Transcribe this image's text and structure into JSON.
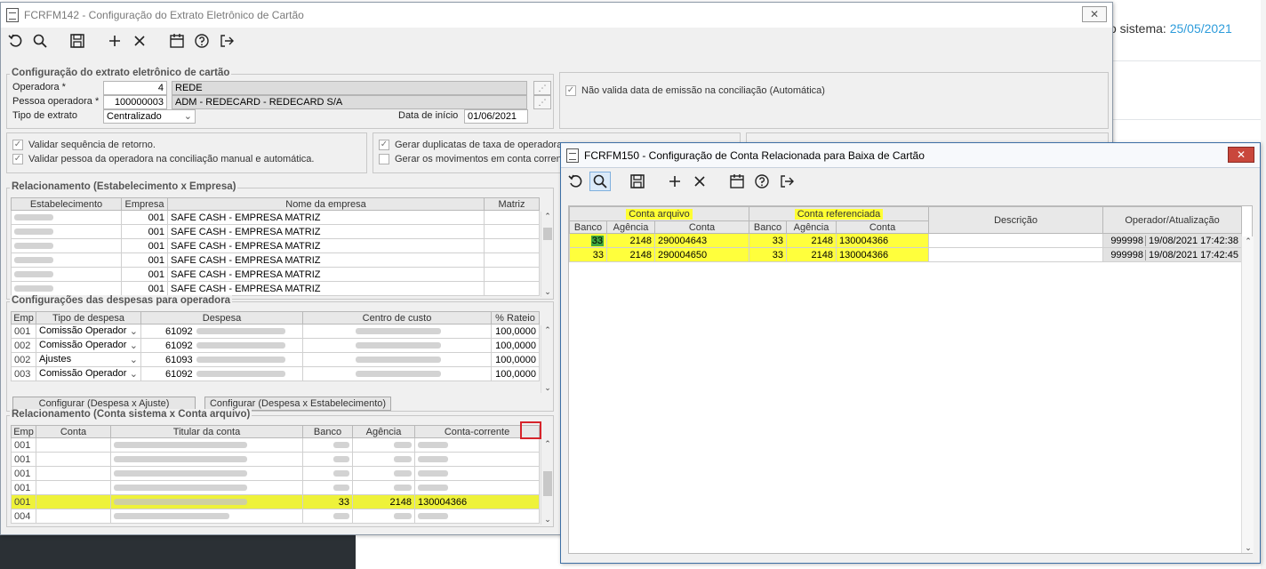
{
  "background": {
    "system_date_label": "o sistema:",
    "system_date": "25/05/2021"
  },
  "win1": {
    "title": "FCRFM142 - Configuração do Extrato Eletrônico de Cartão",
    "close": "✕",
    "config_group": {
      "label": "Configuração do extrato eletrônico de cartão",
      "operadora_label": "Operadora *",
      "operadora_value": "4",
      "operadora_name": "REDE",
      "pessoa_label": "Pessoa operadora *",
      "pessoa_value": "100000003",
      "pessoa_name": "ADM - REDECARD - REDECARD S/A",
      "tipo_label": "Tipo de extrato",
      "tipo_value": "Centralizado",
      "data_label": "Data de início",
      "data_value": "01/06/2021",
      "nao_valida": "Não valida data de emissão na conciliação (Automática)"
    },
    "checks": {
      "validar_seq": "Validar sequência de retorno.",
      "validar_pessoa": "Validar pessoa da operadora na conciliação manual e automática.",
      "gerar_dup": "Gerar duplicatas de taxa de operadora",
      "gerar_mov": "Gerar os movimentos em conta corren"
    },
    "rel_estab": {
      "label": "Relacionamento (Estabelecimento x Empresa)",
      "headers": [
        "Estabelecimento",
        "Empresa",
        "Nome da empresa",
        "Matriz"
      ],
      "rows": [
        {
          "empresa": "001",
          "nome": "SAFE CASH - EMPRESA MATRIZ"
        },
        {
          "empresa": "001",
          "nome": "SAFE CASH - EMPRESA MATRIZ"
        },
        {
          "empresa": "001",
          "nome": "SAFE CASH - EMPRESA MATRIZ"
        },
        {
          "empresa": "001",
          "nome": "SAFE CASH - EMPRESA MATRIZ"
        },
        {
          "empresa": "001",
          "nome": "SAFE CASH - EMPRESA MATRIZ"
        },
        {
          "empresa": "001",
          "nome": "SAFE CASH - EMPRESA MATRIZ"
        }
      ]
    },
    "desp": {
      "label": "Configurações das despesas para operadora",
      "headers": [
        "Emp",
        "Tipo de despesa",
        "Despesa",
        "Centro de custo",
        "% Rateio"
      ],
      "rows": [
        {
          "emp": "001",
          "tipo": "Comissão Operador",
          "despesa": "61092",
          "rateio": "100,0000"
        },
        {
          "emp": "002",
          "tipo": "Comissão Operador",
          "despesa": "61092",
          "rateio": "100,0000"
        },
        {
          "emp": "002",
          "tipo": "Ajustes",
          "despesa": "61093",
          "rateio": "100,0000"
        },
        {
          "emp": "003",
          "tipo": "Comissão Operador",
          "despesa": "61092",
          "rateio": "100,0000"
        }
      ],
      "btn_ajuste": "Configurar (Despesa x Ajuste)",
      "btn_estab": "Configurar (Despesa x Estabelecimento)"
    },
    "rel_conta": {
      "label": "Relacionamento (Conta sistema x Conta arquivo)",
      "headers": [
        "Emp",
        "Conta",
        "Titular da conta",
        "Banco",
        "Agência",
        "Conta-corrente"
      ],
      "rows": [
        {
          "emp": "001",
          "banco": "",
          "agencia": "",
          "conta": ""
        },
        {
          "emp": "001",
          "banco": "",
          "agencia": "",
          "conta": ""
        },
        {
          "emp": "001",
          "banco": "",
          "agencia": "",
          "conta": ""
        },
        {
          "emp": "001",
          "banco": "",
          "agencia": "",
          "conta": ""
        },
        {
          "emp": "001",
          "banco": "33",
          "agencia": "2148",
          "conta": "130004366"
        },
        {
          "emp": "004",
          "banco": "",
          "agencia": "",
          "conta": ""
        }
      ]
    }
  },
  "win2": {
    "title": "FCRFM150 - Configuração de Conta Relacionada para Baixa de Cartão",
    "close": "✕",
    "group_arquivo": "Conta arquivo",
    "group_ref": "Conta referenciada",
    "col_descricao": "Descrição",
    "col_operador": "Operador/Atualização",
    "sub_headers": [
      "Banco",
      "Agência",
      "Conta",
      "Banco",
      "Agência",
      "Conta"
    ],
    "rows": [
      {
        "banco": "33",
        "agencia": "2148",
        "conta": "290004643",
        "ref_banco": "33",
        "ref_agencia": "2148",
        "ref_conta": "130004366",
        "descricao": "",
        "operador": "999998",
        "atualizacao": "19/08/2021 17:42:38"
      },
      {
        "banco": "33",
        "agencia": "2148",
        "conta": "290004650",
        "ref_banco": "33",
        "ref_agencia": "2148",
        "ref_conta": "130004366",
        "descricao": "",
        "operador": "999998",
        "atualizacao": "19/08/2021 17:42:45"
      }
    ]
  }
}
